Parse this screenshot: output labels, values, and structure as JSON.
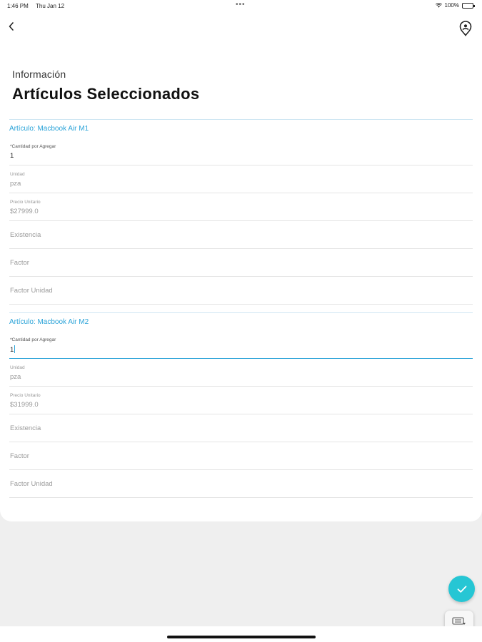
{
  "status_bar": {
    "time": "1:46 PM",
    "date": "Thu Jan 12",
    "dots": "•••",
    "battery": "100%"
  },
  "header": {
    "overline": "Información",
    "title": "Artículos Seleccionados"
  },
  "items": [
    {
      "section_title": "Artículo: Macbook Air M1",
      "quantity_label": "*Cantidad por Agregar",
      "quantity_value": "1",
      "unit_label": "Unidad",
      "unit_value": "pza",
      "price_label": "Precio Unitario",
      "price_value": "$27999.0",
      "stock_placeholder": "Existencia",
      "factor_placeholder": "Factor",
      "factor_unit_placeholder": "Factor Unidad"
    },
    {
      "section_title": "Artículo: Macbook Air M2",
      "quantity_label": "*Cantidad por Agregar",
      "quantity_value": "1",
      "unit_label": "Unidad",
      "unit_value": "pza",
      "price_label": "Precio Unitario",
      "price_value": "$31999.0",
      "stock_placeholder": "Existencia",
      "factor_placeholder": "Factor",
      "factor_unit_placeholder": "Factor Unidad"
    }
  ],
  "icons": {
    "back": "chevron-left-icon",
    "location": "location-pin-icon",
    "confirm": "check-icon",
    "keyboard": "keyboard-icon"
  },
  "colors": {
    "accent": "#2aa3d8",
    "fab": "#26c6d4",
    "background": "#efefef",
    "card": "#ffffff"
  }
}
